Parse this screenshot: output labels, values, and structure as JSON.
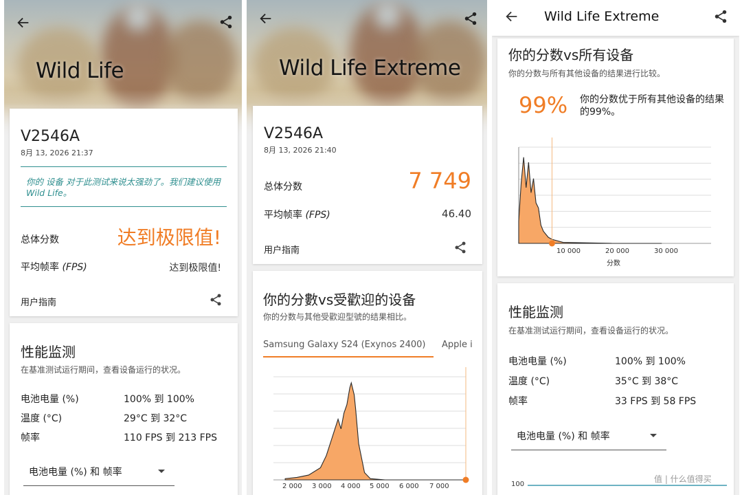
{
  "panel1": {
    "title": "Wild Life",
    "device": "V2546A",
    "date": "8月 13, 2026 21:37",
    "notice": "你的 设备 对于此测试来说太强劲了。我们建议使用 Wild Life。",
    "score_label": "总体分数",
    "score_value": "达到极限值!",
    "fps_label": "平均帧率",
    "fps_unit": "(FPS)",
    "fps_value": "达到极限值!",
    "guide": "用户指南",
    "monitor_title": "性能监测",
    "monitor_sub": "在基准测试运行期间，查看设备运行的状况。",
    "rows": [
      {
        "label": "电池电量 (%)",
        "value": "100% 到 100%"
      },
      {
        "label": "温度 (°C)",
        "value": "29°C 到 32°C"
      },
      {
        "label": "帧率",
        "value": "110 FPS 到 213 FPS"
      }
    ],
    "dropdown": "电池电量 (%) 和 帧率"
  },
  "panel2": {
    "title": "Wild Life Extreme",
    "device": "V2546A",
    "date": "8月 13, 2026 21:40",
    "score_label": "总体分数",
    "score_value": "7 749",
    "fps_label": "平均帧率",
    "fps_unit": "(FPS)",
    "fps_value": "46.40",
    "guide": "用户指南",
    "compare_title": "你的分數vs受歡迎的设备",
    "compare_sub": "你的分数与其他受歡迎型號的结果相比。",
    "tabs": [
      "Samsung Galaxy S24 (Exynos 2400)",
      "Apple i"
    ],
    "chart_ticks": [
      "2 000",
      "3 000",
      "4 000",
      "5 000",
      "6 000",
      "7 000"
    ]
  },
  "panel3": {
    "title": "Wild Life Extreme",
    "compare_title": "你的分数vs所有设备",
    "compare_sub": "你的分数与所有其他设备的结果进行比较。",
    "percent": "99%",
    "percent_text": "你的分数优于所有其他设备的结果的99%。",
    "chart_ticks": [
      "10 000",
      "20 000",
      "30 000"
    ],
    "xlabel": "分数",
    "monitor_title": "性能监测",
    "monitor_sub": "在基准测试运行期间，查看设备运行的状况。",
    "rows": [
      {
        "label": "电池电量 (%)",
        "value": "100% 到 100%"
      },
      {
        "label": "温度 (°C)",
        "value": "35°C 到 38°C"
      },
      {
        "label": "帧率",
        "value": "33 FPS 到 58 FPS"
      }
    ],
    "dropdown": "电池电量 (%) 和 帧率",
    "axis_start": "100"
  },
  "watermark": "值 | 什么值得买",
  "colors": {
    "accent": "#f07d26",
    "teal": "#2f8f8f"
  },
  "chart_data": [
    {
      "type": "area",
      "x": [
        1600,
        2000,
        2400,
        2800,
        3000,
        3200,
        3400,
        3500,
        3600,
        3700,
        3800,
        3850,
        3950,
        4000,
        4100,
        4300,
        4500,
        5000,
        7000,
        7749
      ],
      "values": [
        1,
        2,
        4,
        10,
        20,
        35,
        50,
        42,
        55,
        62,
        76,
        80,
        70,
        58,
        30,
        6,
        1,
        0,
        0,
        0
      ],
      "marker": 7749
    },
    {
      "type": "area",
      "x": [
        1000,
        1500,
        2000,
        2500,
        3000,
        3500,
        4000,
        4500,
        5000,
        5500,
        6000,
        7000,
        7749,
        10000,
        20000,
        30000
      ],
      "values": [
        22,
        60,
        85,
        55,
        80,
        50,
        64,
        40,
        35,
        18,
        12,
        6,
        4,
        1,
        0,
        0
      ],
      "marker": 7749
    }
  ]
}
